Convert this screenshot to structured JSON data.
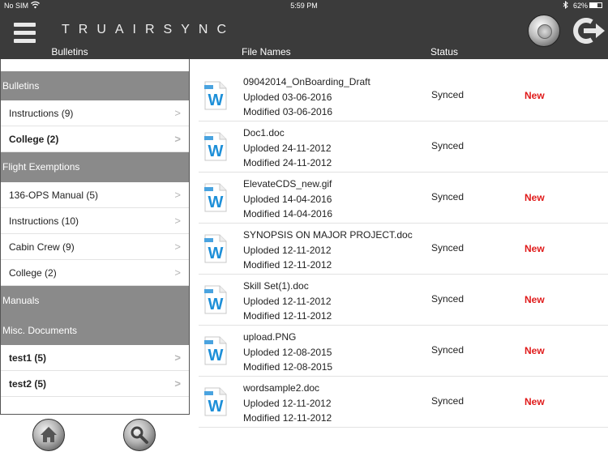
{
  "status_bar": {
    "carrier": "No SIM",
    "time": "5:59 PM",
    "battery": "62%",
    "battery_level": 0.62
  },
  "header": {
    "app_title": "TRUAIRSYNC",
    "columns": {
      "bulletins": "Bulletins",
      "file_names": "File Names",
      "status": "Status"
    }
  },
  "sidebar": {
    "sections": [
      {
        "title": "Bulletins",
        "items": [
          {
            "label": "Instructions (9)",
            "bold": false
          },
          {
            "label": "College (2)",
            "bold": true
          }
        ]
      },
      {
        "title": "Flight Exemptions",
        "items": [
          {
            "label": "136-OPS Manual (5)",
            "bold": false
          },
          {
            "label": "Instructions (10)",
            "bold": false
          },
          {
            "label": "Cabin Crew (9)",
            "bold": false
          },
          {
            "label": "College (2)",
            "bold": false
          }
        ]
      },
      {
        "title": "Manuals",
        "items": []
      },
      {
        "title": "Misc. Documents",
        "items": [
          {
            "label": "test1 (5)",
            "bold": true
          },
          {
            "label": "test2 (5)",
            "bold": true
          }
        ]
      }
    ]
  },
  "files": [
    {
      "name": "09042014_OnBoarding_Draft",
      "uploaded": "Uploded 03-06-2016",
      "modified": "Modified 03-06-2016",
      "status": "Synced",
      "badge": "New"
    },
    {
      "name": "Doc1.doc",
      "uploaded": "Uploded 24-11-2012",
      "modified": "Modified 24-11-2012",
      "status": "Synced",
      "badge": ""
    },
    {
      "name": "ElevateCDS_new.gif",
      "uploaded": "Uploded 14-04-2016",
      "modified": "Modified 14-04-2016",
      "status": "Synced",
      "badge": "New"
    },
    {
      "name": "SYNOPSIS ON MAJOR PROJECT.doc",
      "uploaded": "Uploded 12-11-2012",
      "modified": "Modified 12-11-2012",
      "status": "Synced",
      "badge": "New"
    },
    {
      "name": "Skill Set(1).doc",
      "uploaded": "Uploded 12-11-2012",
      "modified": "Modified 12-11-2012",
      "status": "Synced",
      "badge": "New"
    },
    {
      "name": "upload.PNG",
      "uploaded": "Uploded 12-08-2015",
      "modified": "Modified 12-08-2015",
      "status": "Synced",
      "badge": "New"
    },
    {
      "name": "wordsample2.doc",
      "uploaded": "Uploded 12-11-2012",
      "modified": "Modified 12-11-2012",
      "status": "Synced",
      "badge": "New"
    }
  ],
  "icons": {
    "menu": "hamburger-menu-icon",
    "settings": "settings-knob-icon",
    "logout": "logout-icon",
    "home": "home-icon",
    "search": "search-icon",
    "file": "word-document-icon",
    "chevron": "chevron-right-icon"
  },
  "colors": {
    "header_bg": "#3b3b3b",
    "section_bg": "#8a8a8a",
    "badge_new": "#e01b1b"
  }
}
